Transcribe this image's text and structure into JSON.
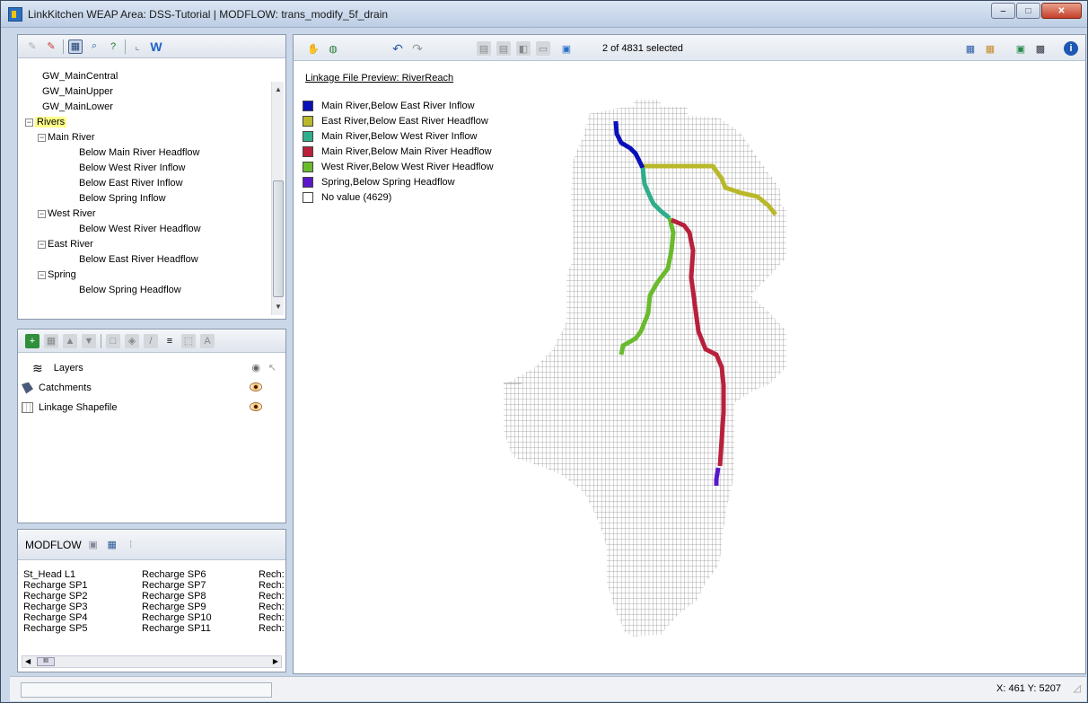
{
  "window": {
    "title": "LinkKitchen   WEAP Area: DSS-Tutorial | MODFLOW: trans_modify_5f_drain",
    "controls": [
      "minimize",
      "maximize",
      "close"
    ]
  },
  "tree": {
    "items": [
      {
        "label": "GW_MainCentral",
        "level": 2
      },
      {
        "label": "GW_MainUpper",
        "level": 2
      },
      {
        "label": "GW_MainLower",
        "level": 2
      },
      {
        "label": "Rivers",
        "level": 0,
        "expander": "−",
        "highlighted": true
      },
      {
        "label": "Main River",
        "level": 1,
        "expander": "−"
      },
      {
        "label": "Below Main River Headflow",
        "level": 2
      },
      {
        "label": "Below West River Inflow",
        "level": 2
      },
      {
        "label": "Below East River Inflow",
        "level": 2
      },
      {
        "label": "Below Spring Inflow",
        "level": 2
      },
      {
        "label": "West River",
        "level": 1,
        "expander": "−"
      },
      {
        "label": "Below West River Headflow",
        "level": 2
      },
      {
        "label": "East River",
        "level": 1,
        "expander": "−"
      },
      {
        "label": "Below East River Headflow",
        "level": 2
      },
      {
        "label": "Spring",
        "level": 1,
        "expander": "−"
      },
      {
        "label": "Below Spring Headflow",
        "level": 2
      }
    ]
  },
  "layers": {
    "header": "Layers",
    "items": [
      {
        "label": "Catchments"
      },
      {
        "label": "Linkage Shapefile"
      }
    ]
  },
  "modflow": {
    "title": "MODFLOW",
    "columns": [
      [
        "St_Head L1",
        "Recharge SP1",
        "Recharge SP2",
        "Recharge SP3",
        "Recharge SP4",
        "Recharge SP5"
      ],
      [
        "Recharge SP6",
        "Recharge SP7",
        "Recharge SP8",
        "Recharge SP9",
        "Recharge SP10",
        "Recharge SP11"
      ],
      [
        "Rech:",
        "Rech:",
        "Rech:",
        "Rech:",
        "Rech:",
        "Rech:"
      ]
    ]
  },
  "map": {
    "selection_text": "2 of 4831 selected",
    "preview_title": "Linkage File Preview: RiverReach",
    "legend": [
      {
        "label": "Main River,Below East River Inflow",
        "color": "#0a10b8"
      },
      {
        "label": "East River,Below East River Headflow",
        "color": "#b9b82a"
      },
      {
        "label": "Main River,Below West River Inflow",
        "color": "#2fae8c"
      },
      {
        "label": "Main River,Below Main River Headflow",
        "color": "#b8203c"
      },
      {
        "label": "West River,Below West River Headflow",
        "color": "#6aba2e"
      },
      {
        "label": "Spring,Below Spring Headflow",
        "color": "#5a18c8"
      },
      {
        "label": "No value (4629)",
        "color": "#ffffff"
      }
    ]
  },
  "status": {
    "coords": "X: 461  Y: 5207"
  }
}
